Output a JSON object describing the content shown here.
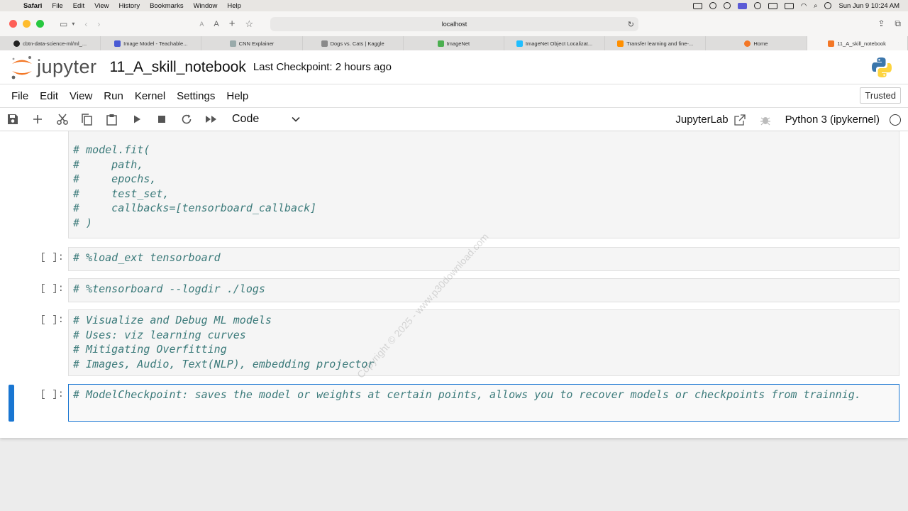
{
  "macos_menubar": {
    "app": "Safari",
    "items": [
      "File",
      "Edit",
      "View",
      "History",
      "Bookmarks",
      "Window",
      "Help"
    ],
    "datetime": "Sun Jun 9  10:24 AM"
  },
  "browser": {
    "url": "localhost",
    "tabs": [
      {
        "label": "cbtn-data-science-ml/ml_...",
        "active": false
      },
      {
        "label": "Image Model - Teachable...",
        "active": false
      },
      {
        "label": "CNN Explainer",
        "active": false
      },
      {
        "label": "Dogs vs. Cats | Kaggle",
        "active": false
      },
      {
        "label": "ImageNet",
        "active": false
      },
      {
        "label": "ImageNet Object Localizat...",
        "active": false
      },
      {
        "label": "Transfer learning and fine-...",
        "active": false
      },
      {
        "label": "Home",
        "active": false
      },
      {
        "label": "11_A_skill_notebook",
        "active": true
      }
    ]
  },
  "jupyter": {
    "logo_text": "jupyter",
    "notebook_title": "11_A_skill_notebook",
    "checkpoint": "Last Checkpoint: 2 hours ago",
    "menu": [
      "File",
      "Edit",
      "View",
      "Run",
      "Kernel",
      "Settings",
      "Help"
    ],
    "trusted": "Trusted",
    "cell_type": "Code",
    "lab_link": "JupyterLab",
    "kernel": "Python 3 (ipykernel)"
  },
  "cells": [
    {
      "prompt": "",
      "source": "# model.fit(\n#     path,\n#     epochs,\n#     test_set,\n#     callbacks=[tensorboard_callback]\n# )",
      "active": false
    },
    {
      "prompt": "[ ]:",
      "source": "# %load_ext tensorboard",
      "active": false
    },
    {
      "prompt": "[ ]:",
      "source": "# %tensorboard --logdir ./logs",
      "active": false
    },
    {
      "prompt": "[ ]:",
      "source": "# Visualize and Debug ML models\n# Uses: viz learning curves\n# Mitigating Overfitting\n# Images, Audio, Text(NLP), embedding projector",
      "active": false
    },
    {
      "prompt": "[ ]:",
      "source": "# ModelCheckpoint: saves the model or weights at certain points, allows you to recover models or checkpoints from trainnig.\n",
      "active": true
    }
  ],
  "watermark": "Copyright © 2025 - www.p30download.com"
}
